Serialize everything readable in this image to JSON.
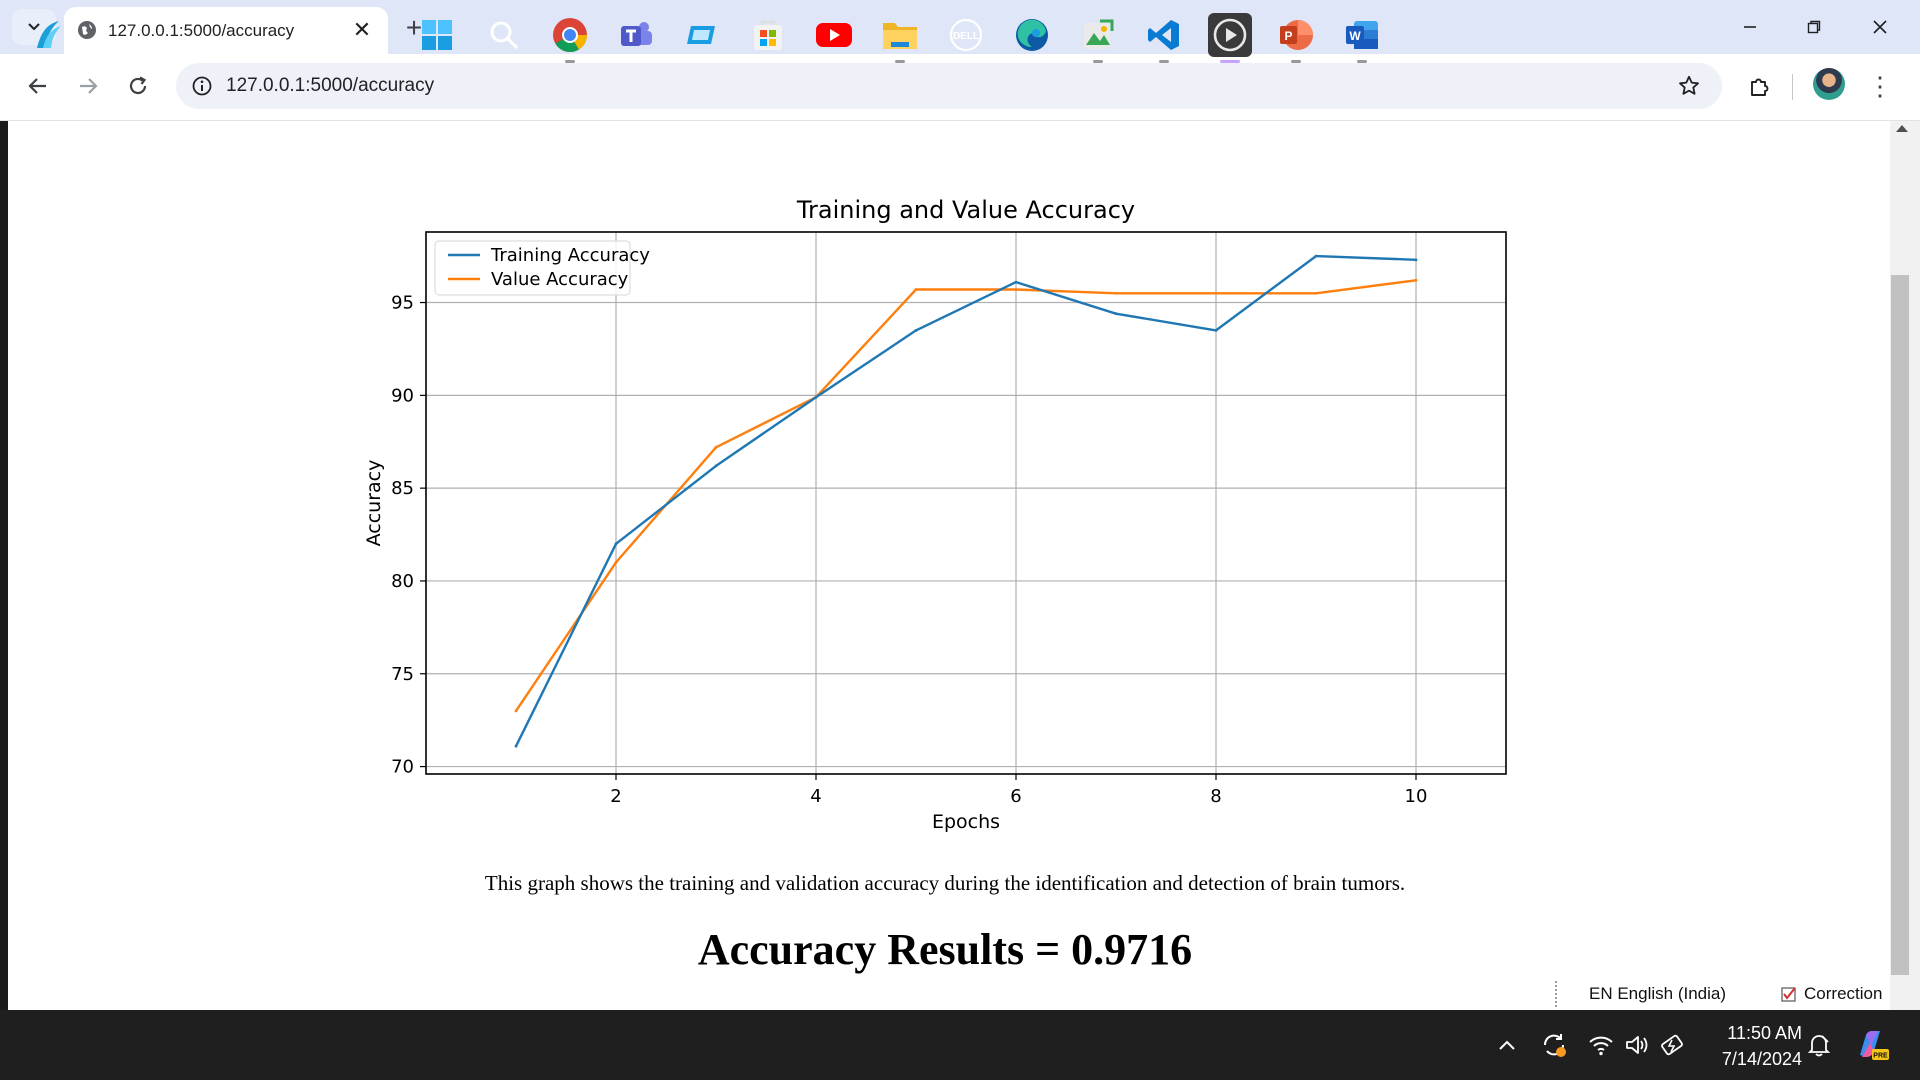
{
  "browser": {
    "tab_title": "127.0.0.1:5000/accuracy",
    "url": "127.0.0.1:5000/accuracy"
  },
  "page": {
    "caption": "This graph shows the training and validation accuracy during the identification and detection of brain tumors.",
    "result": "Accuracy Results = 0.9716"
  },
  "chart_data": {
    "type": "line",
    "title": "Training and Value Accuracy",
    "xlabel": "Epochs",
    "ylabel": "Accuracy",
    "x": [
      1,
      2,
      3,
      4,
      5,
      6,
      7,
      8,
      9,
      10
    ],
    "xticks": [
      2,
      4,
      6,
      8,
      10
    ],
    "yticks": [
      70,
      75,
      80,
      85,
      90,
      95
    ],
    "xlim": [
      0.1,
      10.9
    ],
    "ylim": [
      69.6,
      98.8
    ],
    "grid": true,
    "legend_position": "upper-left",
    "series": [
      {
        "name": "Training Accuracy",
        "color": "#1f77b4",
        "values": [
          71.1,
          82.0,
          86.2,
          89.9,
          93.5,
          96.1,
          94.4,
          93.5,
          97.5,
          97.3
        ]
      },
      {
        "name": "Value Accuracy",
        "color": "#ff7f0e",
        "values": [
          73.0,
          81.0,
          87.2,
          89.9,
          95.7,
          95.7,
          95.5,
          95.5,
          95.5,
          96.2
        ]
      }
    ]
  },
  "language_bar": {
    "language": "EN English (India)",
    "correction": "Correction"
  },
  "taskbar": {
    "apps": [
      "weather-widget",
      "start",
      "search",
      "chrome",
      "teams",
      "remote-app",
      "microsoft-store",
      "youtube",
      "file-explorer",
      "dell",
      "edge",
      "green-app",
      "vscode",
      "media-player",
      "powerpoint",
      "word"
    ],
    "time": "11:50 AM",
    "date": "7/14/2024"
  }
}
